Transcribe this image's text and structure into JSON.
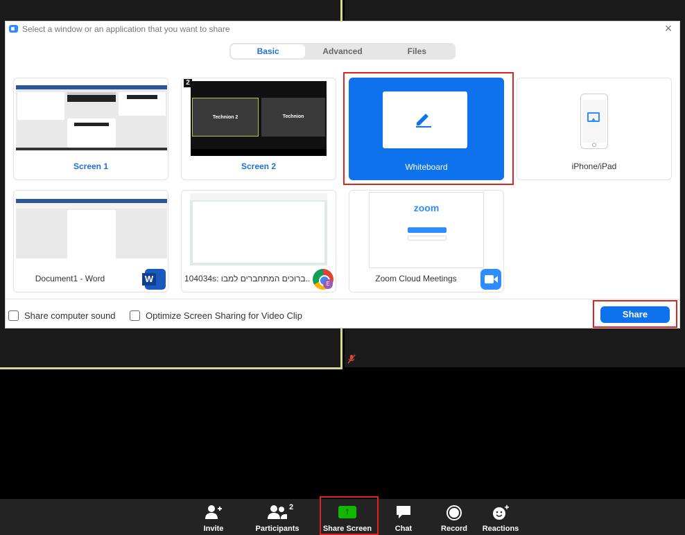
{
  "dialog": {
    "title": "Select a window or an application that you want to share",
    "tabs": [
      {
        "label": "Basic",
        "active": true
      },
      {
        "label": "Advanced",
        "active": false
      },
      {
        "label": "Files",
        "active": false
      }
    ],
    "cards": [
      {
        "label": "Screen 1"
      },
      {
        "label": "Screen 2",
        "badge": "2",
        "panes": [
          "Technion 2",
          "Technion"
        ]
      },
      {
        "label": "Whiteboard",
        "selected": true
      },
      {
        "label": "iPhone/iPad"
      },
      {
        "label": "Document1 - Word"
      },
      {
        "label": "104034s: ברוכים המתחברים למבו..."
      },
      {
        "label": "Zoom Cloud Meetings",
        "logo_text": "zoom"
      }
    ],
    "options": [
      {
        "label": "Share computer sound",
        "checked": false
      },
      {
        "label": "Optimize Screen Sharing for Video Clip",
        "checked": false
      }
    ],
    "share_label": "Share",
    "chrome_profile_initial": "E"
  },
  "toolbar": {
    "items": [
      {
        "label": "Invite",
        "icon": "add-user-icon"
      },
      {
        "label": "Participants",
        "icon": "participants-icon",
        "count": "2"
      },
      {
        "label": "Share Screen",
        "icon": "share-screen-icon"
      },
      {
        "label": "Chat",
        "icon": "chat-icon"
      },
      {
        "label": "Record",
        "icon": "record-icon"
      },
      {
        "label": "Reactions",
        "icon": "reactions-icon"
      }
    ]
  },
  "colors": {
    "accent": "#0e72ed",
    "highlight": "#e0231f",
    "share_green": "#12b800"
  }
}
